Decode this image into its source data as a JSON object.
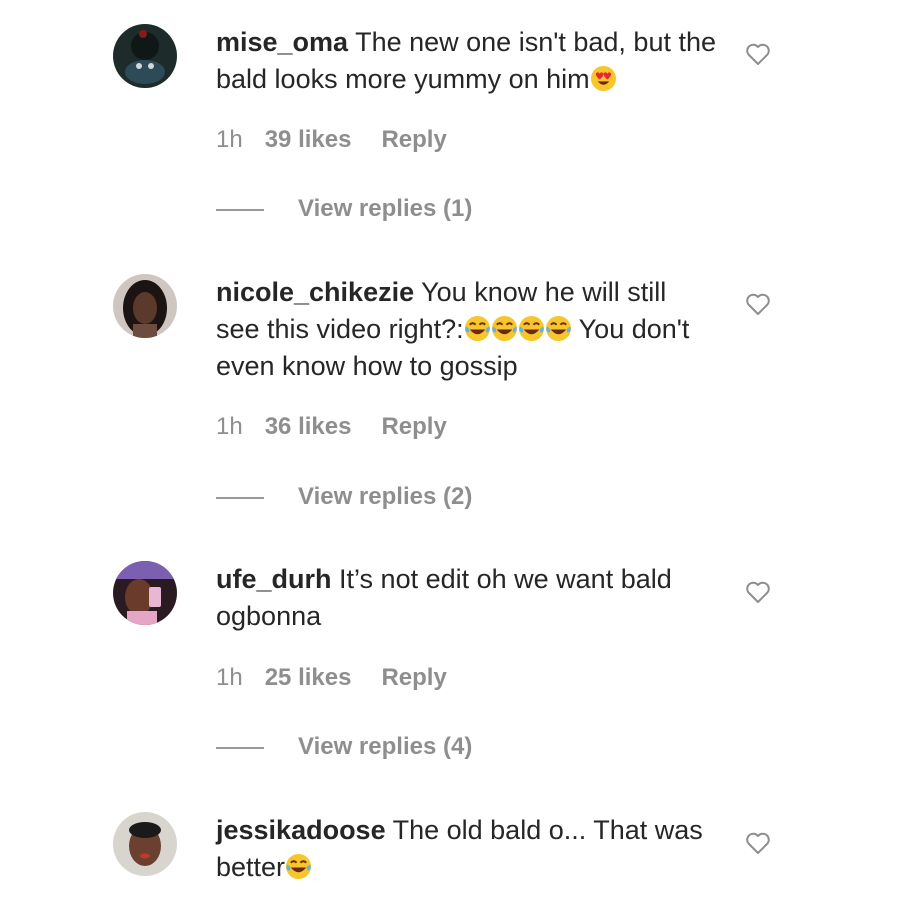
{
  "comments": [
    {
      "username": "mise_oma",
      "text": "The new one isn't bad, but the bald looks more yummy on him",
      "emoji": "heart-eyes",
      "time": "1h",
      "likes": "39 likes",
      "reply": "Reply",
      "view_replies": "View replies (1)"
    },
    {
      "username": "nicole_chikezie",
      "text_before": "You know he will still see this video right?:",
      "text_after": " You don't even know how to gossip",
      "emoji": "tears-of-joy",
      "emoji_count": 4,
      "time": "1h",
      "likes": "36 likes",
      "reply": "Reply",
      "view_replies": "View replies (2)"
    },
    {
      "username": "ufe_durh",
      "text": "It’s not edit oh we want bald ogbonna",
      "time": "1h",
      "likes": "25 likes",
      "reply": "Reply",
      "view_replies": "View replies (4)"
    },
    {
      "username": "jessikadoose",
      "text": "The old bald o... That was better",
      "emoji": "tears-of-joy"
    }
  ],
  "icons": {
    "like": "heart-outline-icon"
  },
  "colors": {
    "text": "#262626",
    "meta": "#8e8e8e",
    "emoji_yellow": "#f7c52c"
  }
}
